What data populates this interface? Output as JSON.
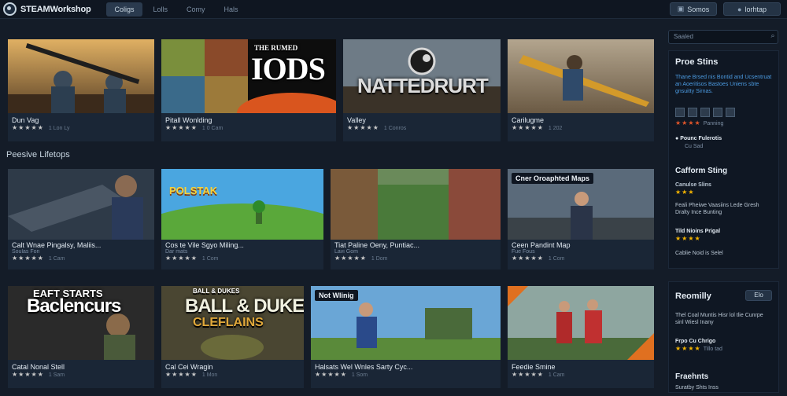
{
  "app": {
    "title": "STEAMWorkshop"
  },
  "nav": [
    "Coligs",
    "Lolls",
    "Comy",
    "Hals"
  ],
  "top_actions": {
    "search": "Somos",
    "account": "lorhtap"
  },
  "sections": {
    "second": "Peesive Lifetops"
  },
  "cards": [
    {
      "title": "Dun Vag",
      "sub": "",
      "stars": "★★★★★",
      "count": "1 Lon Ly",
      "thumb_text": "",
      "tag": ""
    },
    {
      "title": "Pitall Wonlding",
      "sub": "",
      "stars": "★★★★★",
      "count": "1 0 Cam",
      "thumb_text": "THE RUMED IODS",
      "tag": ""
    },
    {
      "title": "Valley",
      "sub": "",
      "stars": "★★★★★",
      "count": "1 Conros",
      "thumb_text": "NATTEDRURT",
      "tag": ""
    },
    {
      "title": "Carilugme",
      "sub": "",
      "stars": "★★★★★",
      "count": "1 202",
      "thumb_text": "",
      "tag": ""
    },
    {
      "title": "Calt Wnae Pingalsy, Maliis...",
      "sub": "Soulas Fon",
      "stars": "★★★★★",
      "count": "1 Cam",
      "thumb_text": "",
      "tag": ""
    },
    {
      "title": "Cos te Vile Sgyo Miling...",
      "sub": "Dar mats",
      "stars": "★★★★★",
      "count": "1 Com",
      "thumb_text": "POLSTAK",
      "tag": ""
    },
    {
      "title": "Tiat Paline Oeny, Puntiac...",
      "sub": "Lavi Gom",
      "stars": "★★★★★",
      "count": "1 Dom",
      "thumb_text": "",
      "tag": ""
    },
    {
      "title": "Ceen Pandint Map",
      "sub": "Fue Fous",
      "stars": "★★★★★",
      "count": "1 Com",
      "thumb_text": "",
      "tag": "Cner Oroaphted Maps"
    },
    {
      "title": "Catal Nonal Stell",
      "sub": "",
      "stars": "★★★★★",
      "count": "1 Sam",
      "thumb_text": "EAFT STARTS Baclencurs",
      "tag": ""
    },
    {
      "title": "Cal Cei Wragin",
      "sub": "",
      "stars": "★★★★★",
      "count": "1 Mon",
      "thumb_text": "BALL & DUKES CLEFLAINS",
      "tag": ""
    },
    {
      "title": "Halsats Wel Wnles Sarty Cyc...",
      "sub": "",
      "stars": "★★★★★",
      "count": "1 Som",
      "thumb_text": "",
      "tag": "Not Wlinig"
    },
    {
      "title": "Feedie Smine",
      "sub": "",
      "stars": "★★★★★",
      "count": "1 Cam",
      "thumb_text": "",
      "tag": ""
    }
  ],
  "sidebar": {
    "search_placeholder": "Saaled",
    "panel1": {
      "title": "Proe Stins",
      "text": "Thane Brsed nis Bontid and Ucsentruat an Aoeritisos Bastoes Uniens sbte gnsuitty Sirnas.",
      "stars1": "★★★★",
      "stars1_label": "Panning",
      "item1_title": "Pounc Fulerotis",
      "item1_sub": "Cu Sad",
      "sub_title": "Cafform Sting",
      "sub1": "Canulse Slins",
      "sub1_stars": "★★★",
      "sub2": "Feali Pheiwe Vaasiins Lede Gresh Dralty Ince Bunting",
      "sub3": "Tild Nioins Prigal",
      "sub3_stars": "★★★★",
      "sub4": "Cablie Noid is Selel"
    },
    "panel2": {
      "title": "Reomilly",
      "button": "Elo",
      "text": "Thel Coal Muntis Hisr lol tlie Cunrpe sinl Wiesl Inany",
      "item1": "Frpo Cu Chrigo",
      "item1_stars": "★★★★",
      "item1_sub": "Tillo tad",
      "item2": "Fraehnts",
      "item2_sub": "Suratby Shts Inss"
    }
  },
  "colors": {
    "bg": "#141c28",
    "topbar": "#0f1621",
    "card": "#1a2636",
    "star_gold": "#f4b400"
  }
}
